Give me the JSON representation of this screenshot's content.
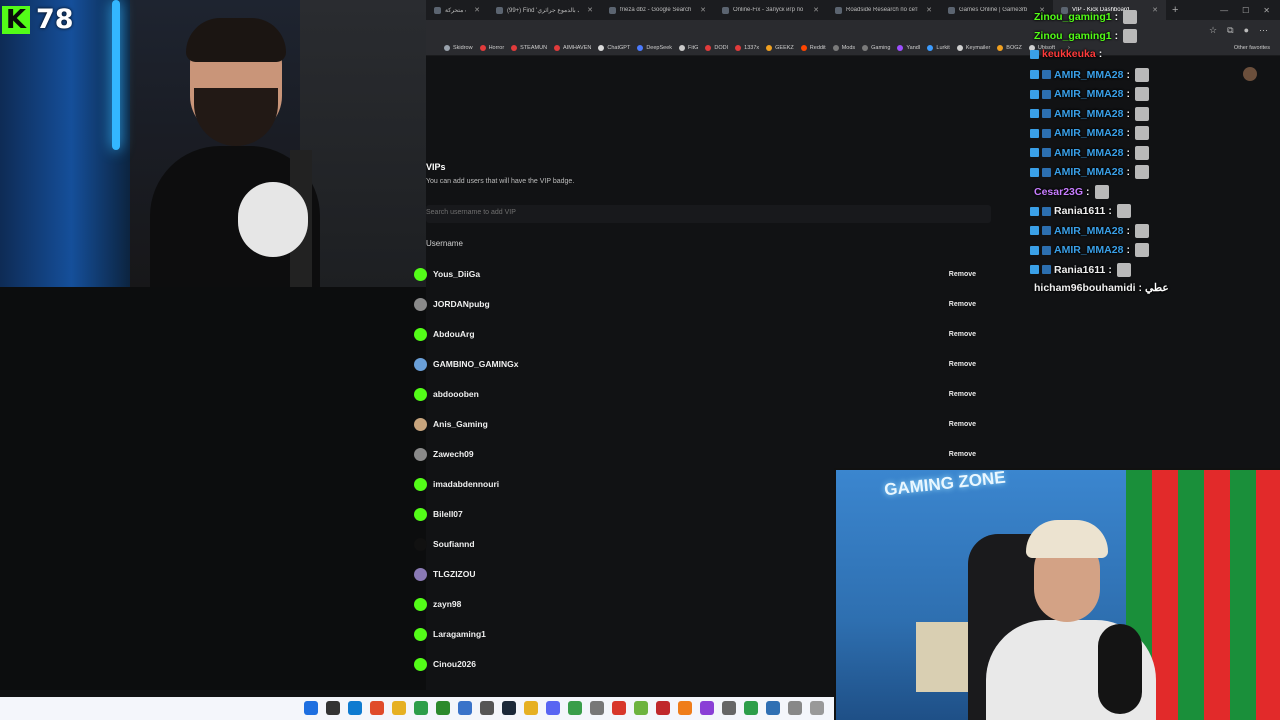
{
  "browser": {
    "tabs": [
      {
        "label": "ثيوبيات متحركة",
        "active": false
      },
      {
        "label": "(99+) Find 'شوتك بالدموع جرائري'",
        "active": false
      },
      {
        "label": "frieza dbz - Google Search",
        "active": false
      },
      {
        "label": "Online-Fix - Запуск игр по сети",
        "active": false
      },
      {
        "label": "Roadside Research по сети без",
        "active": false
      },
      {
        "label": "Games Online | Game3rb",
        "active": false
      },
      {
        "label": "VIP - Kick Dashboard",
        "active": true
      }
    ],
    "new_tab_label": "+",
    "window_controls": [
      "—",
      "☐",
      "✕"
    ],
    "bookmarks": [
      {
        "label": "Skidrow",
        "color": "#9aa3ad"
      },
      {
        "label": "Horror",
        "color": "#e23b3b"
      },
      {
        "label": "STEAMUN",
        "color": "#e23b3b"
      },
      {
        "label": "AIMHAVEN",
        "color": "#e23b3b"
      },
      {
        "label": "ChatGPT",
        "color": "#d9d9d9"
      },
      {
        "label": "DeepSeek",
        "color": "#4b7bff"
      },
      {
        "label": "FitG",
        "color": "#c9c9c9"
      },
      {
        "label": "DODI",
        "color": "#e23b3b"
      },
      {
        "label": "1337x",
        "color": "#e23b3b"
      },
      {
        "label": "GEEKZ",
        "color": "#f0a020"
      },
      {
        "label": "Reddit",
        "color": "#ff4500"
      },
      {
        "label": "Mods",
        "color": "#7a7a7a"
      },
      {
        "label": "Gaming",
        "color": "#7a7a7a"
      },
      {
        "label": "YandI",
        "color": "#9d4fff"
      },
      {
        "label": "Lurkit",
        "color": "#3c9cff"
      },
      {
        "label": "Keymailer",
        "color": "#cfcfcf"
      },
      {
        "label": "BOGZ",
        "color": "#f0a020"
      },
      {
        "label": "Ubisoft",
        "color": "#cfcfcf"
      }
    ],
    "other_favorites_label": "Other favorites"
  },
  "vip_page": {
    "title": "VIPs",
    "description": "You can add users that will have the VIP badge.",
    "search_placeholder": "Search username to add VIP",
    "column_header": "Username",
    "remove_label": "Remove",
    "users": [
      {
        "name": "Yous_DiiGa",
        "avatar_color": "#53fc18",
        "has_remove": true
      },
      {
        "name": "JORDANpubg",
        "avatar_color": "#8a8a8a",
        "has_remove": true
      },
      {
        "name": "AbdouArg",
        "avatar_color": "#53fc18",
        "has_remove": true
      },
      {
        "name": "GAMBINO_GAMINGx",
        "avatar_color": "#6a9fd8",
        "has_remove": true
      },
      {
        "name": "abdoooben",
        "avatar_color": "#53fc18",
        "has_remove": true
      },
      {
        "name": "Anis_Gaming",
        "avatar_color": "#c7a47d",
        "has_remove": true
      },
      {
        "name": "Zawech09",
        "avatar_color": "#8a8a8a",
        "has_remove": true
      },
      {
        "name": "imadabdennouri",
        "avatar_color": "#53fc18",
        "has_remove": false
      },
      {
        "name": "Bilell07",
        "avatar_color": "#53fc18",
        "has_remove": false
      },
      {
        "name": "Soufiannd",
        "avatar_color": "#111111",
        "has_remove": false
      },
      {
        "name": "TLGZIZOU",
        "avatar_color": "#8a7ab5",
        "has_remove": false
      },
      {
        "name": "zayn98",
        "avatar_color": "#53fc18",
        "has_remove": false
      },
      {
        "name": "Laragaming1",
        "avatar_color": "#53fc18",
        "has_remove": false
      },
      {
        "name": "Cinou2026",
        "avatar_color": "#53fc18",
        "has_remove": false
      }
    ]
  },
  "overlay": {
    "kick_logo": "K",
    "viewer_count": "78",
    "accent_green": "#53fc18"
  },
  "chat": [
    {
      "user": "Zinou_gaming1",
      "color": "#53fc18",
      "badges": 0,
      "msg": "",
      "emote": true
    },
    {
      "user": "Zinou_gaming1",
      "color": "#53fc18",
      "badges": 0,
      "msg": "",
      "emote": true
    },
    {
      "user": "keukkeuka",
      "color": "#ff3b3b",
      "badges": 1,
      "msg": "",
      "emote": false
    },
    {
      "user": "AMIR_MMA28",
      "color": "#3aa0e8",
      "badges": 2,
      "msg": "",
      "emote": true
    },
    {
      "user": "AMIR_MMA28",
      "color": "#3aa0e8",
      "badges": 2,
      "msg": "",
      "emote": true
    },
    {
      "user": "AMIR_MMA28",
      "color": "#3aa0e8",
      "badges": 2,
      "msg": "",
      "emote": true
    },
    {
      "user": "AMIR_MMA28",
      "color": "#3aa0e8",
      "badges": 2,
      "msg": "",
      "emote": true
    },
    {
      "user": "AMIR_MMA28",
      "color": "#3aa0e8",
      "badges": 2,
      "msg": "",
      "emote": true
    },
    {
      "user": "AMIR_MMA28",
      "color": "#3aa0e8",
      "badges": 2,
      "msg": "",
      "emote": true
    },
    {
      "user": "Cesar23G",
      "color": "#c77dff",
      "badges": 0,
      "msg": "",
      "emote": true
    },
    {
      "user": "Rania1611",
      "color": "#f0f0f0",
      "badges": 2,
      "msg": "",
      "emote": true
    },
    {
      "user": "AMIR_MMA28",
      "color": "#3aa0e8",
      "badges": 2,
      "msg": "",
      "emote": true
    },
    {
      "user": "AMIR_MMA28",
      "color": "#3aa0e8",
      "badges": 2,
      "msg": "",
      "emote": true
    },
    {
      "user": "Rania1611",
      "color": "#f0f0f0",
      "badges": 2,
      "msg": "",
      "emote": true
    },
    {
      "user": "hicham96bouhamidi",
      "color": "#f0f0f0",
      "badges": 0,
      "msg": "عطي",
      "emote": false
    }
  ],
  "webcam2": {
    "neon_text": "GAMING ZONE"
  },
  "taskbar": {
    "icons": [
      {
        "name": "windows-start-icon",
        "color": "#1e6fe0"
      },
      {
        "name": "search-icon",
        "color": "#333"
      },
      {
        "name": "edge-browser-icon",
        "color": "#0f7bd0"
      },
      {
        "name": "brave-browser-icon",
        "color": "#e04b2a"
      },
      {
        "name": "file-explorer-icon",
        "color": "#e6b022"
      },
      {
        "name": "green-app-icon",
        "color": "#2d9e49"
      },
      {
        "name": "xbox-icon",
        "color": "#2c8a2c"
      },
      {
        "name": "globe-icon",
        "color": "#3a73c9"
      },
      {
        "name": "app-icon-gray",
        "color": "#555"
      },
      {
        "name": "steam-icon",
        "color": "#1b2838"
      },
      {
        "name": "pencil-app-icon",
        "color": "#e6b022"
      },
      {
        "name": "discord-icon",
        "color": "#5865f2"
      },
      {
        "name": "chrome-icon",
        "color": "#3a9e4a"
      },
      {
        "name": "app-icon-gray2",
        "color": "#777"
      },
      {
        "name": "red-app-icon",
        "color": "#d8372b"
      },
      {
        "name": "nvidia-icon",
        "color": "#6db33f"
      },
      {
        "name": "red-app-icon2",
        "color": "#c0282b"
      },
      {
        "name": "orange-app-icon",
        "color": "#ef7d1a"
      },
      {
        "name": "purple-app-icon",
        "color": "#8a3fd6"
      },
      {
        "name": "app-icon-gray3",
        "color": "#666"
      },
      {
        "name": "chart-app-icon",
        "color": "#2d9e49"
      },
      {
        "name": "network-app-icon",
        "color": "#2f6fb3"
      },
      {
        "name": "app-icon-gray4",
        "color": "#888"
      },
      {
        "name": "app-icon-gray5",
        "color": "#999"
      }
    ]
  }
}
